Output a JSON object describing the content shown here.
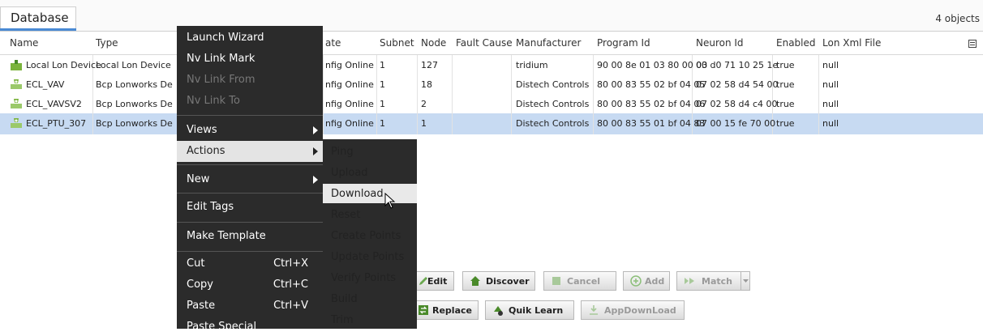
{
  "tab": {
    "label": "Database",
    "count": "4 objects"
  },
  "columns": [
    "Name",
    "Type",
    "ate",
    "Subnet",
    "Node",
    "Fault Cause",
    "Manufacturer",
    "Program Id",
    "Neuron Id",
    "Enabled",
    "Lon Xml File"
  ],
  "rows": [
    {
      "name": "Local Lon Device",
      "type": "Local Lon Device",
      "state": "nfig Online",
      "subnet": "1",
      "node": "127",
      "fault": "",
      "manufacturer": "tridium",
      "program_id": "90 00 8e 01 03 80 00 03",
      "neuron_id": "00 d0 71 10 25 1e",
      "enabled": "true",
      "xml": "null",
      "icon": "local-device-icon"
    },
    {
      "name": "ECL_VAV",
      "type": "Bcp Lonworks De",
      "state": "nfig Online",
      "subnet": "1",
      "node": "18",
      "fault": "",
      "manufacturer": "Distech Controls",
      "program_id": "80 00 83 55 02 bf 04 05",
      "neuron_id": "07 02 58 d4 54 00",
      "enabled": "true",
      "xml": "null",
      "icon": "lon-device-icon"
    },
    {
      "name": "ECL_VAVSV2",
      "type": "Bcp Lonworks De",
      "state": "nfig Online",
      "subnet": "1",
      "node": "2",
      "fault": "",
      "manufacturer": "Distech Controls",
      "program_id": "80 00 83 55 02 bf 04 06",
      "neuron_id": "07 02 58 d4 c4 00",
      "enabled": "true",
      "xml": "null",
      "icon": "lon-device-icon"
    },
    {
      "name": "ECL_PTU_307",
      "type": "Bcp Lonworks De",
      "state": "nfig Online",
      "subnet": "1",
      "node": "1",
      "fault": "",
      "manufacturer": "Distech Controls",
      "program_id": "80 00 83 55 01 bf 04 83",
      "neuron_id": "07 00 15 fe 70 00",
      "enabled": "true",
      "xml": "null",
      "icon": "lon-device-icon"
    }
  ],
  "context_menu": {
    "launch_wizard": "Launch Wizard",
    "nv_link_mark": "Nv Link Mark",
    "nv_link_from": "Nv Link From",
    "nv_link_to": "Nv Link To",
    "views": "Views",
    "actions": "Actions",
    "new": "New",
    "edit_tags": "Edit Tags",
    "make_template": "Make Template",
    "cut": "Cut",
    "cut_sc": "Ctrl+X",
    "copy": "Copy",
    "copy_sc": "Ctrl+C",
    "paste": "Paste",
    "paste_sc": "Ctrl+V",
    "paste_special": "Paste Special"
  },
  "actions_submenu": [
    "Ping",
    "Upload",
    "Download",
    "Reset",
    "Create Points",
    "Update Points",
    "Verify Points",
    "Build",
    "Trim"
  ],
  "buttons": {
    "edit": "Edit",
    "discover": "Discover",
    "cancel": "Cancel",
    "add": "Add",
    "match": "Match",
    "replace": "Replace",
    "quik_learn": "Quik Learn",
    "appdownload": "AppDownLoad"
  }
}
